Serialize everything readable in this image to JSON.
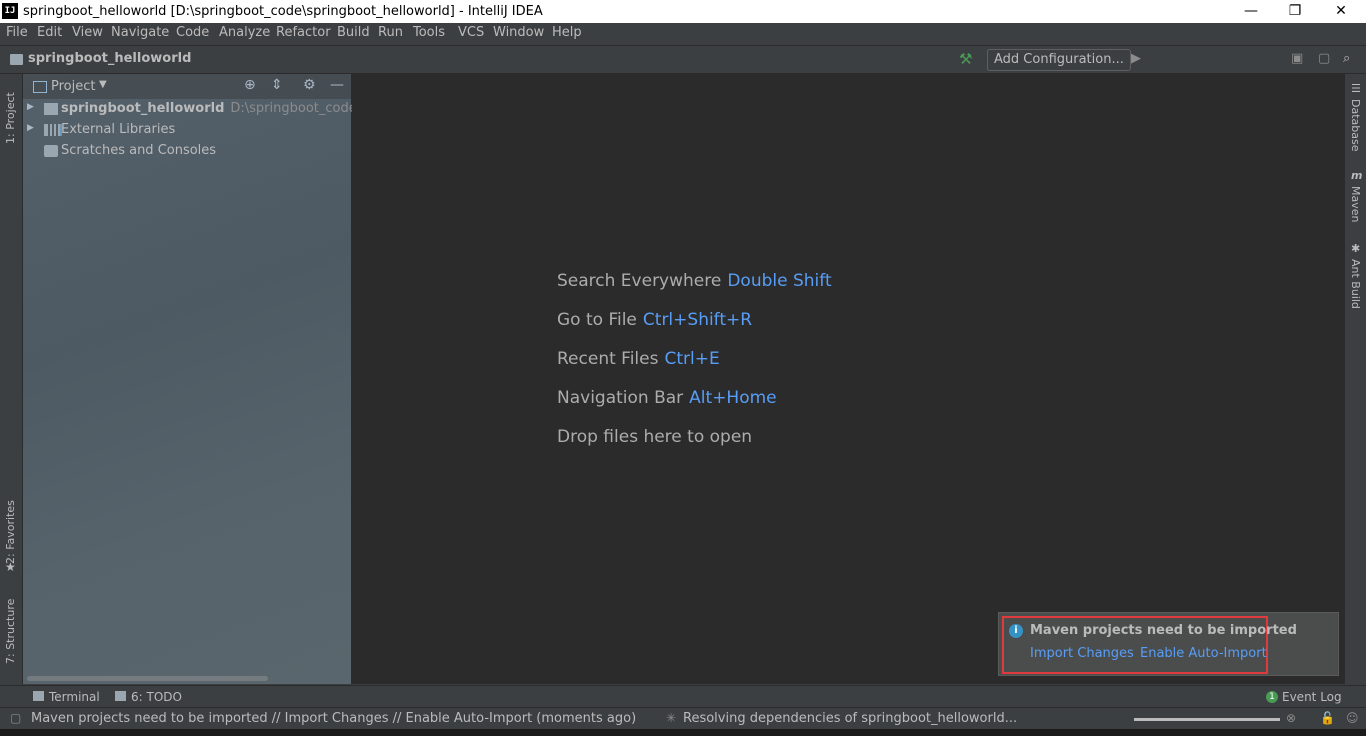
{
  "window": {
    "title": "springboot_helloworld [D:\\springboot_code\\springboot_helloworld] - IntelliJ IDEA",
    "app_icon": "IJ",
    "minimize": "—",
    "restore": "❐",
    "close": "✕"
  },
  "menu": [
    "File",
    "Edit",
    "View",
    "Navigate",
    "Code",
    "Analyze",
    "Refactor",
    "Build",
    "Run",
    "Tools",
    "VCS",
    "Window",
    "Help"
  ],
  "navbar": {
    "breadcrumb": "springboot_helloworld",
    "run_config": "Add Configuration..."
  },
  "left_stripe": {
    "project_tab": "1: Project",
    "favorites_tab": "2: Favorites",
    "structure_tab": "7: Structure"
  },
  "right_stripe": {
    "database_tab": "Database",
    "maven_tab": "Maven",
    "ant_tab": "Ant Build"
  },
  "project_panel": {
    "title": "Project",
    "tree": [
      {
        "label": "springboot_helloworld",
        "path": "D:\\springboot_code\\spri",
        "icon": "module-folder-icon"
      },
      {
        "label": "External Libraries",
        "path": "",
        "icon": "libraries-icon"
      },
      {
        "label": "Scratches and Consoles",
        "path": "",
        "icon": "scratches-icon"
      }
    ]
  },
  "editor": {
    "hints": [
      {
        "text": "Search Everywhere",
        "key": "Double Shift"
      },
      {
        "text": "Go to File",
        "key": "Ctrl+Shift+R"
      },
      {
        "text": "Recent Files",
        "key": "Ctrl+E"
      },
      {
        "text": "Navigation Bar",
        "key": "Alt+Home"
      },
      {
        "text": "Drop files here to open",
        "key": ""
      }
    ]
  },
  "notification": {
    "title": "Maven projects need to be imported",
    "import_changes": "Import Changes",
    "enable_auto_import": "Enable Auto-Import"
  },
  "bottom_tools": {
    "terminal": "Terminal",
    "todo": "6: TODO",
    "event_log": "Event Log",
    "event_count": "1"
  },
  "status": {
    "message": "Maven projects need to be imported // Import Changes // Enable Auto-Import (moments ago)",
    "task": "Resolving dependencies of springboot_helloworld..."
  },
  "colors": {
    "editor_bg": "#2b2b2b",
    "link": "#589df6",
    "highlight_box": "#e0393e",
    "build_green": "#499c54"
  }
}
